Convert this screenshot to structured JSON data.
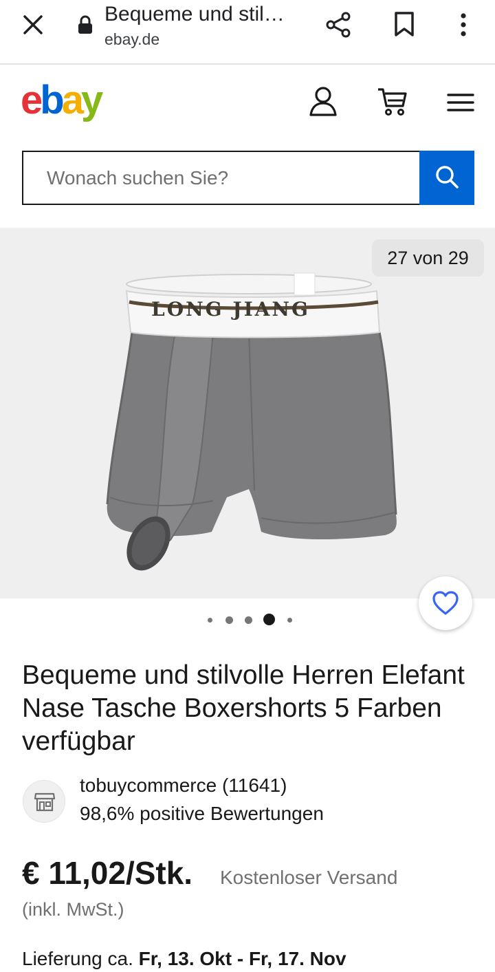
{
  "browser": {
    "page_title": "Bequeme und stil…",
    "host": "ebay.de"
  },
  "header": {
    "logo_letters": [
      "e",
      "b",
      "a",
      "y"
    ],
    "logo_colors": [
      "#e53238",
      "#0064d2",
      "#f5af02",
      "#86b817"
    ]
  },
  "search": {
    "placeholder": "Wonach suchen Sie?",
    "button_color": "#0064d2"
  },
  "gallery": {
    "counter": "27 von 29",
    "product_band_text": "LONG JIANG"
  },
  "product": {
    "title": "Bequeme und stilvolle Herren Elefant Nase Tasche Boxershorts 5 Farben verfügbar"
  },
  "seller": {
    "name": "tobuycommerce (11641)",
    "rating": "98,6% positive Bewertungen"
  },
  "price": {
    "amount": "€ 11,02/Stk.",
    "shipping": "Kostenloser Versand",
    "vat": "(inkl. MwSt.)"
  },
  "delivery": {
    "label": "Lieferung ca.",
    "dates": "Fr, 13. Okt - Fr, 17. Nov"
  }
}
